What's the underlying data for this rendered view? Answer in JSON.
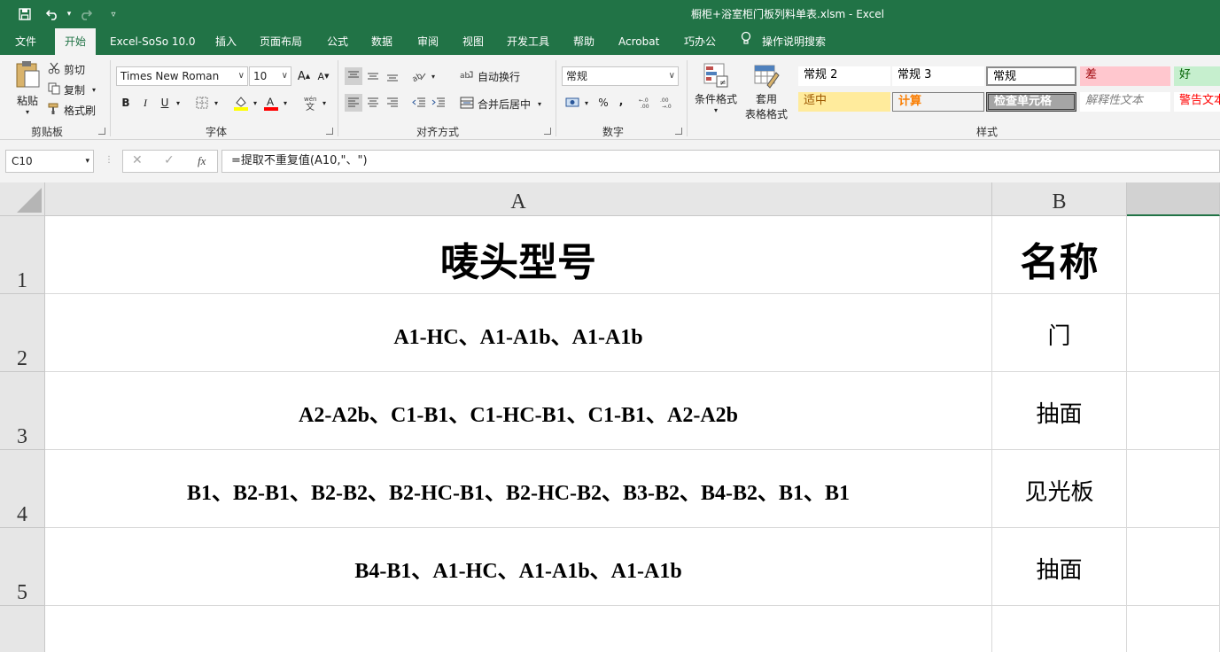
{
  "window": {
    "title": "橱柜+浴室柜门板列料单表.xlsm  -  Excel"
  },
  "menu": {
    "tabs": [
      "文件",
      "开始",
      "Excel-SoSo 10.0",
      "插入",
      "页面布局",
      "公式",
      "数据",
      "审阅",
      "视图",
      "开发工具",
      "帮助",
      "Acrobat",
      "巧办公"
    ],
    "active": "开始",
    "tell_me": "操作说明搜索"
  },
  "ribbon": {
    "clipboard": {
      "paste": "粘贴",
      "cut": "剪切",
      "copy": "复制",
      "format_painter": "格式刷",
      "label": "剪贴板"
    },
    "font": {
      "font_name": "Times New Roman",
      "font_size": "10",
      "bold": "B",
      "italic": "I",
      "underline": "U",
      "label": "字体"
    },
    "alignment": {
      "wrap_text": "自动换行",
      "merge_center": "合并后居中",
      "label": "对齐方式"
    },
    "number": {
      "format": "常规",
      "percent": "%",
      "comma": ",",
      "label": "数字"
    },
    "styles": {
      "conditional_format": "条件格式",
      "format_table_1": "套用",
      "format_table_2": "表格格式",
      "cells": [
        {
          "text": "常规 2",
          "bg": "#ffffff",
          "color": "#000000"
        },
        {
          "text": "常规 3",
          "bg": "#ffffff",
          "color": "#000000"
        },
        {
          "text": "常规",
          "bg": "#ffffff",
          "color": "#000000"
        },
        {
          "text": "差",
          "bg": "#ffc7ce",
          "color": "#9c0006"
        },
        {
          "text": "好",
          "bg": "#c6efce",
          "color": "#006100"
        },
        {
          "text": "适中",
          "bg": "#ffeb9c",
          "color": "#9c5700"
        },
        {
          "text": "计算",
          "bg": "#f2f2f2",
          "color": "#fa7d00"
        },
        {
          "text": "检查单元格",
          "bg": "#a5a5a5",
          "color": "#ffffff"
        },
        {
          "text": "解释性文本",
          "bg": "#ffffff",
          "color": "#7f7f7f"
        },
        {
          "text": "警告文本",
          "bg": "#ffffff",
          "color": "#ff0000"
        }
      ],
      "label": "样式"
    }
  },
  "formula_bar": {
    "name_box": "C10",
    "cancel": "✕",
    "enter": "✓",
    "fx": "fx",
    "formula": "=提取不重复值(A10,\"、\")"
  },
  "sheet": {
    "columns": [
      "A",
      "B"
    ],
    "rows": [
      {
        "num": "1",
        "a": "唛头型号",
        "b": "名称"
      },
      {
        "num": "2",
        "a": "A1-HC、A1-A1b、A1-A1b",
        "b": "门"
      },
      {
        "num": "3",
        "a": "A2-A2b、C1-B1、C1-HC-B1、C1-B1、A2-A2b",
        "b": "抽面"
      },
      {
        "num": "4",
        "a": "B1、B2-B1、B2-B2、B2-HC-B1、B2-HC-B2、B3-B2、B4-B2、B1、B1",
        "b": "见光板"
      },
      {
        "num": "5",
        "a": "B4-B1、A1-HC、A1-A1b、A1-A1b",
        "b": "抽面"
      }
    ]
  },
  "colors": {
    "brand": "#217346",
    "ribbon_bg": "#f3f3f3",
    "header_bg": "#e6e6e6"
  }
}
